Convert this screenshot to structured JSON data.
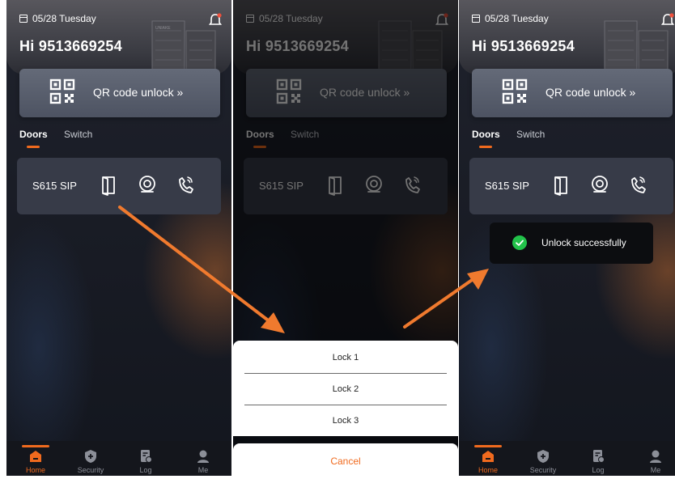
{
  "header": {
    "date": "05/28 Tuesday",
    "greeting": "Hi 9513669254"
  },
  "qr": {
    "label": "QR code unlock »"
  },
  "tabs": {
    "doors": "Doors",
    "switch": "Switch"
  },
  "door": {
    "name": "S615 SIP"
  },
  "toast": {
    "text": "Unlock successfully"
  },
  "nav": {
    "home": "Home",
    "security": "Security",
    "log": "Log",
    "me": "Me"
  },
  "sheet": {
    "lock1": "Lock 1",
    "lock2": "Lock 2",
    "lock3": "Lock 3",
    "cancel": "Cancel"
  },
  "colors": {
    "accent": "#f06a1e",
    "success": "#22c24a",
    "arrow": "#f07a2e",
    "card": "#373b48"
  }
}
